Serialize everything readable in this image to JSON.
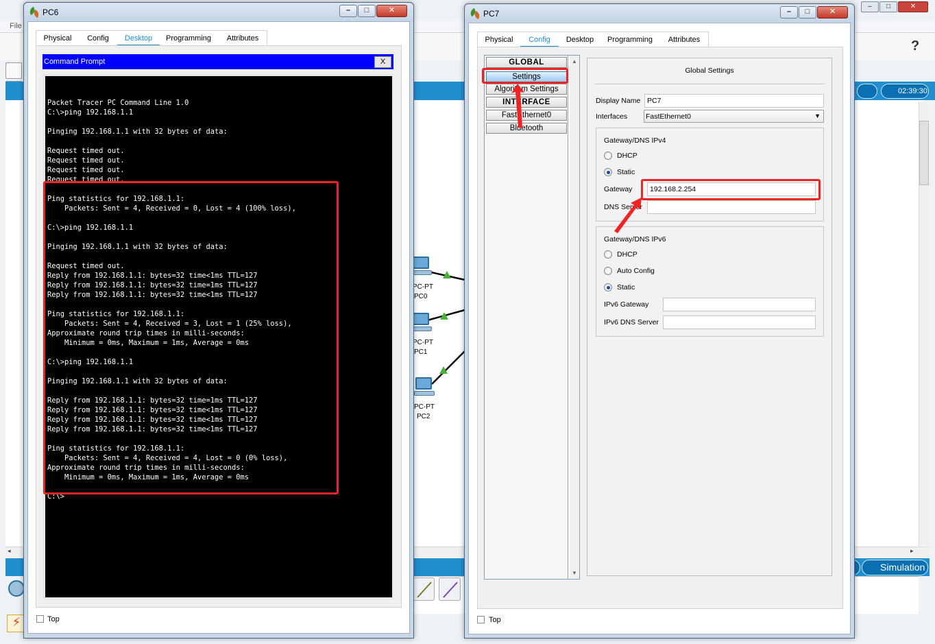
{
  "background_app": {
    "menu_fragment": "File",
    "help_label": "?",
    "clock": "02:39:30",
    "simulation_label": "Simulation",
    "devices": [
      {
        "type": "PC-PT",
        "name": "PC0"
      },
      {
        "type": "PC-PT",
        "name": "PC1"
      },
      {
        "type": "PC-PT",
        "name": "PC2"
      }
    ],
    "window_buttons": {
      "minimize": "–",
      "maximize": "□",
      "close": "✕"
    }
  },
  "pc6": {
    "title": "PC6",
    "tabs": [
      "Physical",
      "Config",
      "Desktop",
      "Programming",
      "Attributes"
    ],
    "active_tab": "Desktop",
    "command_prompt": {
      "title": "Command Prompt",
      "close_label": "X",
      "lines": [
        "",
        "Packet Tracer PC Command Line 1.0",
        "C:\\>ping 192.168.1.1",
        "",
        "Pinging 192.168.1.1 with 32 bytes of data:",
        "",
        "Request timed out.",
        "Request timed out.",
        "Request timed out.",
        "Request timed out.",
        "",
        "Ping statistics for 192.168.1.1:",
        "    Packets: Sent = 4, Received = 0, Lost = 4 (100% loss),",
        "",
        "C:\\>ping 192.168.1.1",
        "",
        "Pinging 192.168.1.1 with 32 bytes of data:",
        "",
        "Request timed out.",
        "Reply from 192.168.1.1: bytes=32 time<1ms TTL=127",
        "Reply from 192.168.1.1: bytes=32 time=1ms TTL=127",
        "Reply from 192.168.1.1: bytes=32 time<1ms TTL=127",
        "",
        "Ping statistics for 192.168.1.1:",
        "    Packets: Sent = 4, Received = 3, Lost = 1 (25% loss),",
        "Approximate round trip times in milli-seconds:",
        "    Minimum = 0ms, Maximum = 1ms, Average = 0ms",
        "",
        "C:\\>ping 192.168.1.1",
        "",
        "Pinging 192.168.1.1 with 32 bytes of data:",
        "",
        "Reply from 192.168.1.1: bytes=32 time=1ms TTL=127",
        "Reply from 192.168.1.1: bytes=32 time<1ms TTL=127",
        "Reply from 192.168.1.1: bytes=32 time<1ms TTL=127",
        "Reply from 192.168.1.1: bytes=32 time<1ms TTL=127",
        "",
        "Ping statistics for 192.168.1.1:",
        "    Packets: Sent = 4, Received = 4, Lost = 0 (0% loss),",
        "Approximate round trip times in milli-seconds:",
        "    Minimum = 0ms, Maximum = 1ms, Average = 0ms",
        "",
        "C:\\>"
      ]
    },
    "top_label": "Top"
  },
  "pc7": {
    "title": "PC7",
    "tabs": [
      "Physical",
      "Config",
      "Desktop",
      "Programming",
      "Attributes"
    ],
    "active_tab": "Config",
    "sidebar": {
      "global_header": "GLOBAL",
      "settings": "Settings",
      "algorithm_settings": "Algorithm Settings",
      "interface_header": "INTERFACE",
      "fastethernet": "FastEthernet0",
      "bluetooth": "Bluetooth"
    },
    "global_settings": {
      "title": "Global Settings",
      "display_name_label": "Display Name",
      "display_name_value": "PC7",
      "interfaces_label": "Interfaces",
      "interfaces_value": "FastEthernet0",
      "ipv4": {
        "title": "Gateway/DNS IPv4",
        "dhcp": "DHCP",
        "static": "Static",
        "mode": "static",
        "gateway_label": "Gateway",
        "gateway_value": "192.168.2.254",
        "dns_label": "DNS Server",
        "dns_value": ""
      },
      "ipv6": {
        "title": "Gateway/DNS IPv6",
        "dhcp": "DHCP",
        "auto_config": "Auto Config",
        "static": "Static",
        "mode": "static",
        "gateway_label": "IPv6 Gateway",
        "gateway_value": "",
        "dns_label": "IPv6 DNS Server",
        "dns_value": ""
      }
    },
    "top_label": "Top"
  },
  "annotation_color": "#f02323"
}
